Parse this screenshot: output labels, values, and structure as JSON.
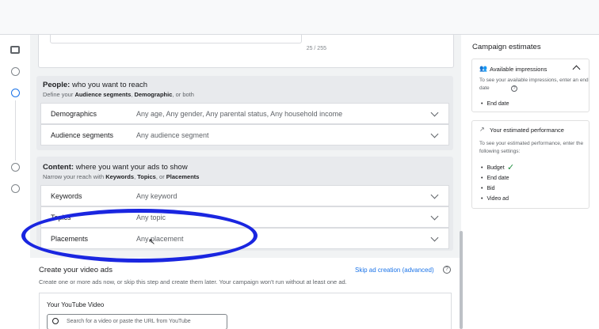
{
  "top": {
    "char_counter": "25 / 255"
  },
  "people": {
    "title_bold": "People:",
    "title_rest": " who you want to reach",
    "subtitle": "Define your Audience segments, Demographic, or both",
    "rows": [
      {
        "label": "Demographics",
        "value": "Any age, Any gender, Any parental status, Any household income"
      },
      {
        "label": "Audience segments",
        "value": "Any audience segment"
      }
    ]
  },
  "content": {
    "title_bold": "Content:",
    "title_rest": " where you want your ads to show",
    "subtitle": "Narrow your reach with Keywords, Topics, or Placements",
    "rows": [
      {
        "label": "Keywords",
        "value": "Any keyword"
      },
      {
        "label": "Topics",
        "value": "Any topic"
      },
      {
        "label": "Placements",
        "value": "Any placement"
      }
    ]
  },
  "create": {
    "title": "Create your video ads",
    "skip_link": "Skip ad creation (advanced)",
    "description": "Create one or more ads now, or skip this step and create them later. Your campaign won't run without at least one ad.",
    "video_heading": "Your YouTube Video",
    "search_placeholder": "Search for a video or paste the URL from YouTube"
  },
  "estimates": {
    "title": "Campaign estimates",
    "impressions": {
      "heading": "Available impressions",
      "text": "To see your available impressions, enter an end date",
      "items": [
        "End date"
      ]
    },
    "performance": {
      "heading": "Your estimated performance",
      "text": "To see your estimated performance, enter the following settings:",
      "items": [
        "Budget",
        "End date",
        "Bid",
        "Video ad"
      ]
    }
  },
  "colors": {
    "annotation": "#1a26e0",
    "link": "#1a73e8",
    "check": "#1e8e3e"
  }
}
